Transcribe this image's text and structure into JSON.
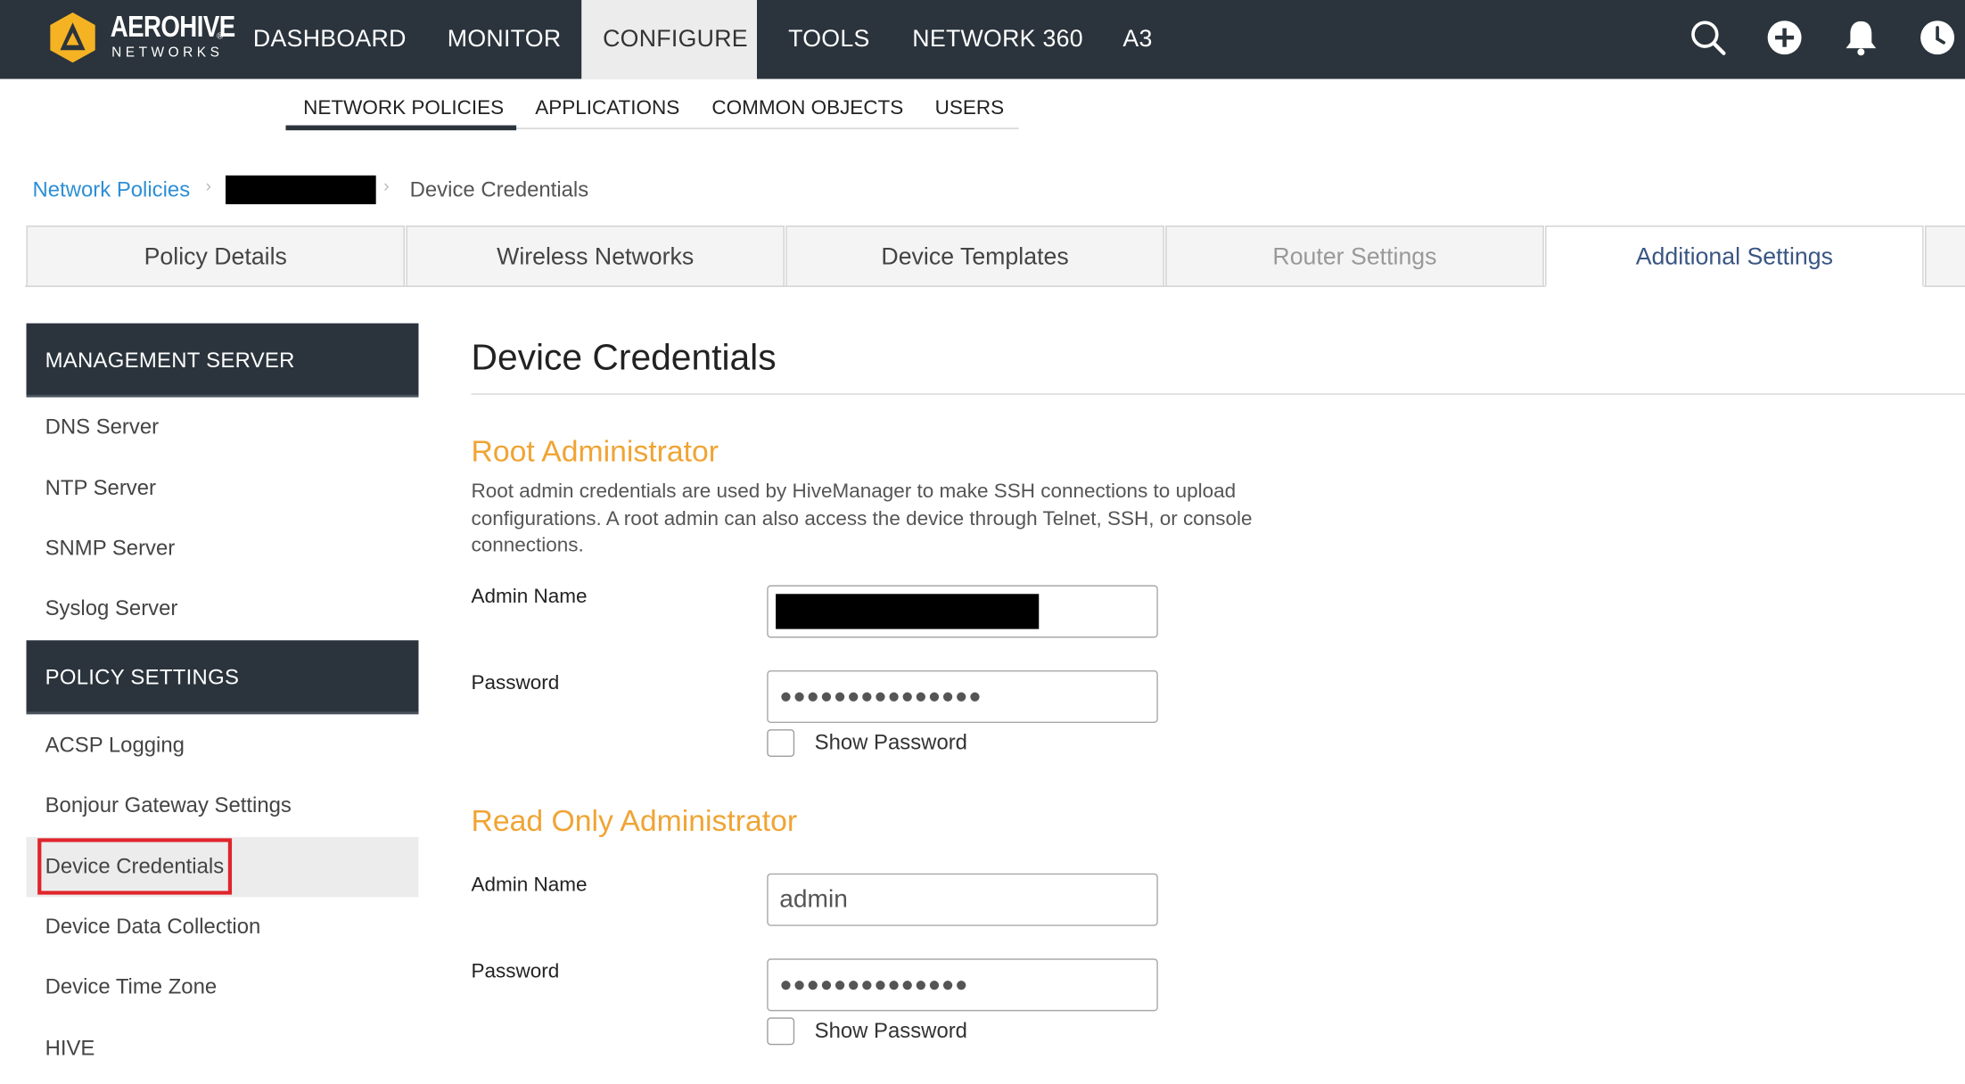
{
  "brand": {
    "name": "AEROHIVE",
    "sub": "NETWORKS",
    "reg": "®",
    "logo_color": "#f5b323"
  },
  "topnav": {
    "items": [
      {
        "label": "DASHBOARD"
      },
      {
        "label": "MONITOR"
      },
      {
        "label": "CONFIGURE",
        "active": true
      },
      {
        "label": "TOOLS"
      },
      {
        "label": "NETWORK 360"
      },
      {
        "label": "A3"
      }
    ],
    "icons": [
      "search-icon",
      "add-icon",
      "bell-icon",
      "clock-icon"
    ]
  },
  "subnav": {
    "items": [
      {
        "label": "NETWORK POLICIES",
        "active": true
      },
      {
        "label": "APPLICATIONS"
      },
      {
        "label": "COMMON OBJECTS"
      },
      {
        "label": "USERS"
      }
    ]
  },
  "breadcrumb": {
    "root": "Network Policies",
    "current": "Device Credentials"
  },
  "tabs": [
    {
      "label": "Policy Details"
    },
    {
      "label": "Wireless Networks"
    },
    {
      "label": "Device Templates"
    },
    {
      "label": "Router Settings",
      "disabled": true
    },
    {
      "label": "Additional Settings",
      "active": true
    }
  ],
  "sidebar": {
    "groups": [
      {
        "header": "MANAGEMENT SERVER",
        "items": [
          "DNS Server",
          "NTP Server",
          "SNMP Server",
          "Syslog Server"
        ]
      },
      {
        "header": "POLICY SETTINGS",
        "items": [
          "ACSP Logging",
          "Bonjour Gateway Settings",
          "Device Credentials",
          "Device Data Collection",
          "Device Time Zone",
          "HIVE"
        ],
        "selected": "Device Credentials"
      }
    ]
  },
  "main": {
    "title": "Device Credentials",
    "root_admin": {
      "title": "Root Administrator",
      "description": "Root admin credentials are used by HiveManager to make SSH connections to upload configurations. A root admin can also access the device through Telnet, SSH, or console connections.",
      "admin_name_label": "Admin Name",
      "admin_name_value": "",
      "password_label": "Password",
      "password_value": "●●●●●●●●●●●●●●●",
      "show_password_label": "Show Password"
    },
    "readonly_admin": {
      "title": "Read Only Administrator",
      "admin_name_label": "Admin Name",
      "admin_name_value": "admin",
      "password_label": "Password",
      "password_value": "●●●●●●●●●●●●●●",
      "show_password_label": "Show Password"
    }
  },
  "colors": {
    "topbar": "#2b343c",
    "accent_orange": "#f0a434",
    "link_blue": "#2d8fd5",
    "active_tab_text": "#3a5683",
    "highlight_red": "#e0242b"
  }
}
